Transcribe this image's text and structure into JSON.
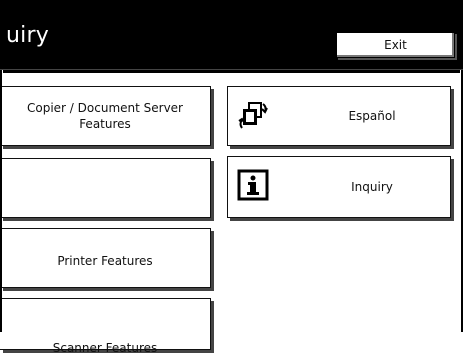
{
  "header": {
    "title": "uiry",
    "exit_label": "Exit"
  },
  "left_buttons": [
    {
      "label": "Copier / Document Server Features"
    },
    {
      "label": ""
    },
    {
      "label": "Printer Features"
    },
    {
      "label": "Scanner Features"
    }
  ],
  "right_buttons": [
    {
      "label": "Español",
      "icon": "language-switch-icon"
    },
    {
      "label": "Inquiry",
      "icon": "info-icon"
    }
  ]
}
